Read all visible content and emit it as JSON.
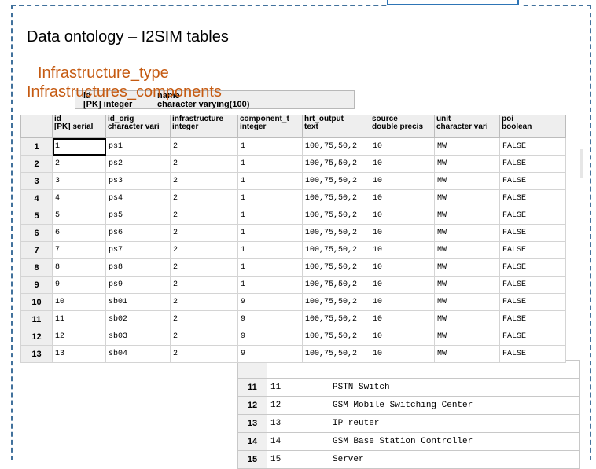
{
  "slide": {
    "title": "Data ontology – I2SIM tables",
    "subtitle_1": "Infrastructure_type",
    "subtitle_2": "Infrastructures_components"
  },
  "infra_type_header": {
    "col1_name": "id",
    "col1_type": "[PK] integer",
    "col2_name": "name",
    "col2_type": "character varying(100)"
  },
  "components_table": {
    "headers": [
      {
        "name": "id",
        "type": "[PK] serial"
      },
      {
        "name": "id_orig",
        "type": "character vari"
      },
      {
        "name": "infrastructure",
        "type": "integer"
      },
      {
        "name": "component_t",
        "type": "integer"
      },
      {
        "name": "hrt_output",
        "type": "text"
      },
      {
        "name": "source",
        "type": "double precis"
      },
      {
        "name": "unit",
        "type": "character vari"
      },
      {
        "name": "poi",
        "type": "boolean"
      }
    ],
    "rows": [
      {
        "n": "1",
        "cells": [
          "1",
          "ps1",
          "2",
          "1",
          "100,75,50,2",
          "10",
          "MW",
          "FALSE"
        ]
      },
      {
        "n": "2",
        "cells": [
          "2",
          "ps2",
          "2",
          "1",
          "100,75,50,2",
          "10",
          "MW",
          "FALSE"
        ]
      },
      {
        "n": "3",
        "cells": [
          "3",
          "ps3",
          "2",
          "1",
          "100,75,50,2",
          "10",
          "MW",
          "FALSE"
        ]
      },
      {
        "n": "4",
        "cells": [
          "4",
          "ps4",
          "2",
          "1",
          "100,75,50,2",
          "10",
          "MW",
          "FALSE"
        ]
      },
      {
        "n": "5",
        "cells": [
          "5",
          "ps5",
          "2",
          "1",
          "100,75,50,2",
          "10",
          "MW",
          "FALSE"
        ]
      },
      {
        "n": "6",
        "cells": [
          "6",
          "ps6",
          "2",
          "1",
          "100,75,50,2",
          "10",
          "MW",
          "FALSE"
        ]
      },
      {
        "n": "7",
        "cells": [
          "7",
          "ps7",
          "2",
          "1",
          "100,75,50,2",
          "10",
          "MW",
          "FALSE"
        ]
      },
      {
        "n": "8",
        "cells": [
          "8",
          "ps8",
          "2",
          "1",
          "100,75,50,2",
          "10",
          "MW",
          "FALSE"
        ]
      },
      {
        "n": "9",
        "cells": [
          "9",
          "ps9",
          "2",
          "1",
          "100,75,50,2",
          "10",
          "MW",
          "FALSE"
        ]
      },
      {
        "n": "10",
        "cells": [
          "10",
          "sb01",
          "2",
          "9",
          "100,75,50,2",
          "10",
          "MW",
          "FALSE"
        ]
      },
      {
        "n": "11",
        "cells": [
          "11",
          "sb02",
          "2",
          "9",
          "100,75,50,2",
          "10",
          "MW",
          "FALSE"
        ]
      },
      {
        "n": "12",
        "cells": [
          "12",
          "sb03",
          "2",
          "9",
          "100,75,50,2",
          "10",
          "MW",
          "FALSE"
        ]
      },
      {
        "n": "13",
        "cells": [
          "13",
          "sb04",
          "2",
          "9",
          "100,75,50,2",
          "10",
          "MW",
          "FALSE"
        ]
      }
    ]
  },
  "infra_type_rows": [
    {
      "n": "11",
      "id": "11",
      "name": "PSTN Switch"
    },
    {
      "n": "12",
      "id": "12",
      "name": "GSM Mobile Switching Center"
    },
    {
      "n": "13",
      "id": "13",
      "name": "IP reuter"
    },
    {
      "n": "14",
      "id": "14",
      "name": "GSM Base Station Controller"
    },
    {
      "n": "15",
      "id": "15",
      "name": "Server"
    }
  ]
}
